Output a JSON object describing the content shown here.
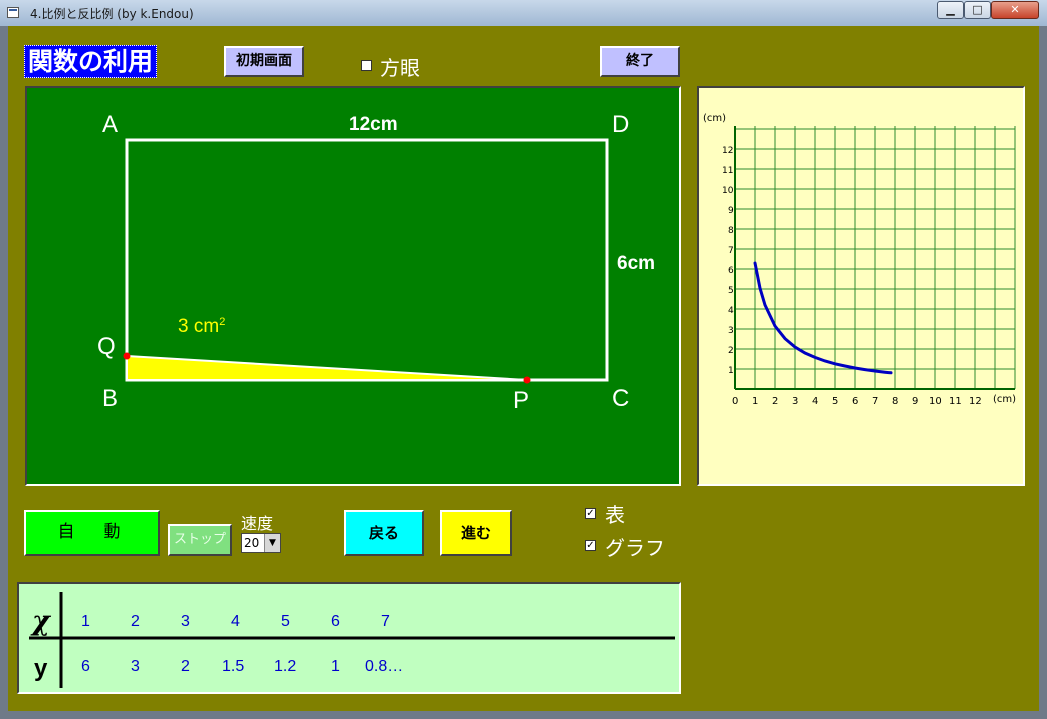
{
  "window": {
    "title": "4.比例と反比例  (by k.Endou)",
    "minimize_glyph": "▁",
    "maximize_glyph": "□",
    "close_glyph": "✕"
  },
  "header": {
    "app_title": "関数の利用",
    "init_button": "初期画面",
    "grid_label": "方眼",
    "grid_checked": false,
    "end_button": "終了"
  },
  "figure": {
    "vertices": {
      "A": "A",
      "B": "B",
      "C": "C",
      "D": "D",
      "P": "P",
      "Q": "Q"
    },
    "width_label": "12cm",
    "height_label": "6cm",
    "area_value": "3 cm",
    "area_sup": "2",
    "rect_width_cm": 12,
    "rect_height_cm": 6,
    "bp_cm": 10,
    "bq_cm": 0.6,
    "colors": {
      "board": "#008000",
      "triangle": "#ffff00",
      "point": "#ff0000"
    }
  },
  "controls": {
    "auto_button": "自　動",
    "stop_button": "ストップ",
    "speed_label": "速度",
    "speed_value": "20",
    "back_button": "戻る",
    "next_button": "進む",
    "table_label": "表",
    "table_checked": true,
    "graph_label": "グラフ",
    "graph_checked": true
  },
  "value_table": {
    "x_header": "χ",
    "y_header": "y",
    "x_values": [
      "1",
      "2",
      "3",
      "4",
      "5",
      "6",
      "7"
    ],
    "y_values": [
      "6",
      "3",
      "2",
      "1.5",
      "1.2",
      "1",
      "0.8…"
    ]
  },
  "chart_data": {
    "type": "line",
    "title": "",
    "xlabel": "(cm)",
    "ylabel": "(cm)",
    "xlim": [
      0,
      14
    ],
    "ylim": [
      0,
      13
    ],
    "x_ticks": [
      "0",
      "1",
      "2",
      "3",
      "4",
      "5",
      "6",
      "7",
      "8",
      "9",
      "10",
      "11",
      "12"
    ],
    "y_ticks": [
      "1",
      "2",
      "3",
      "4",
      "5",
      "6",
      "7",
      "8",
      "9",
      "10",
      "11",
      "12"
    ],
    "grid": true,
    "series": [
      {
        "color": "#0000c0",
        "x": [
          1,
          1.25,
          1.5,
          2,
          2.5,
          3,
          3.5,
          4,
          4.5,
          5,
          5.5,
          6,
          6.5,
          7,
          7.5,
          7.8
        ],
        "y": [
          6.3,
          5.04,
          4.2,
          3.15,
          2.52,
          2.1,
          1.8,
          1.58,
          1.4,
          1.26,
          1.15,
          1.05,
          0.97,
          0.9,
          0.84,
          0.81
        ]
      }
    ]
  }
}
